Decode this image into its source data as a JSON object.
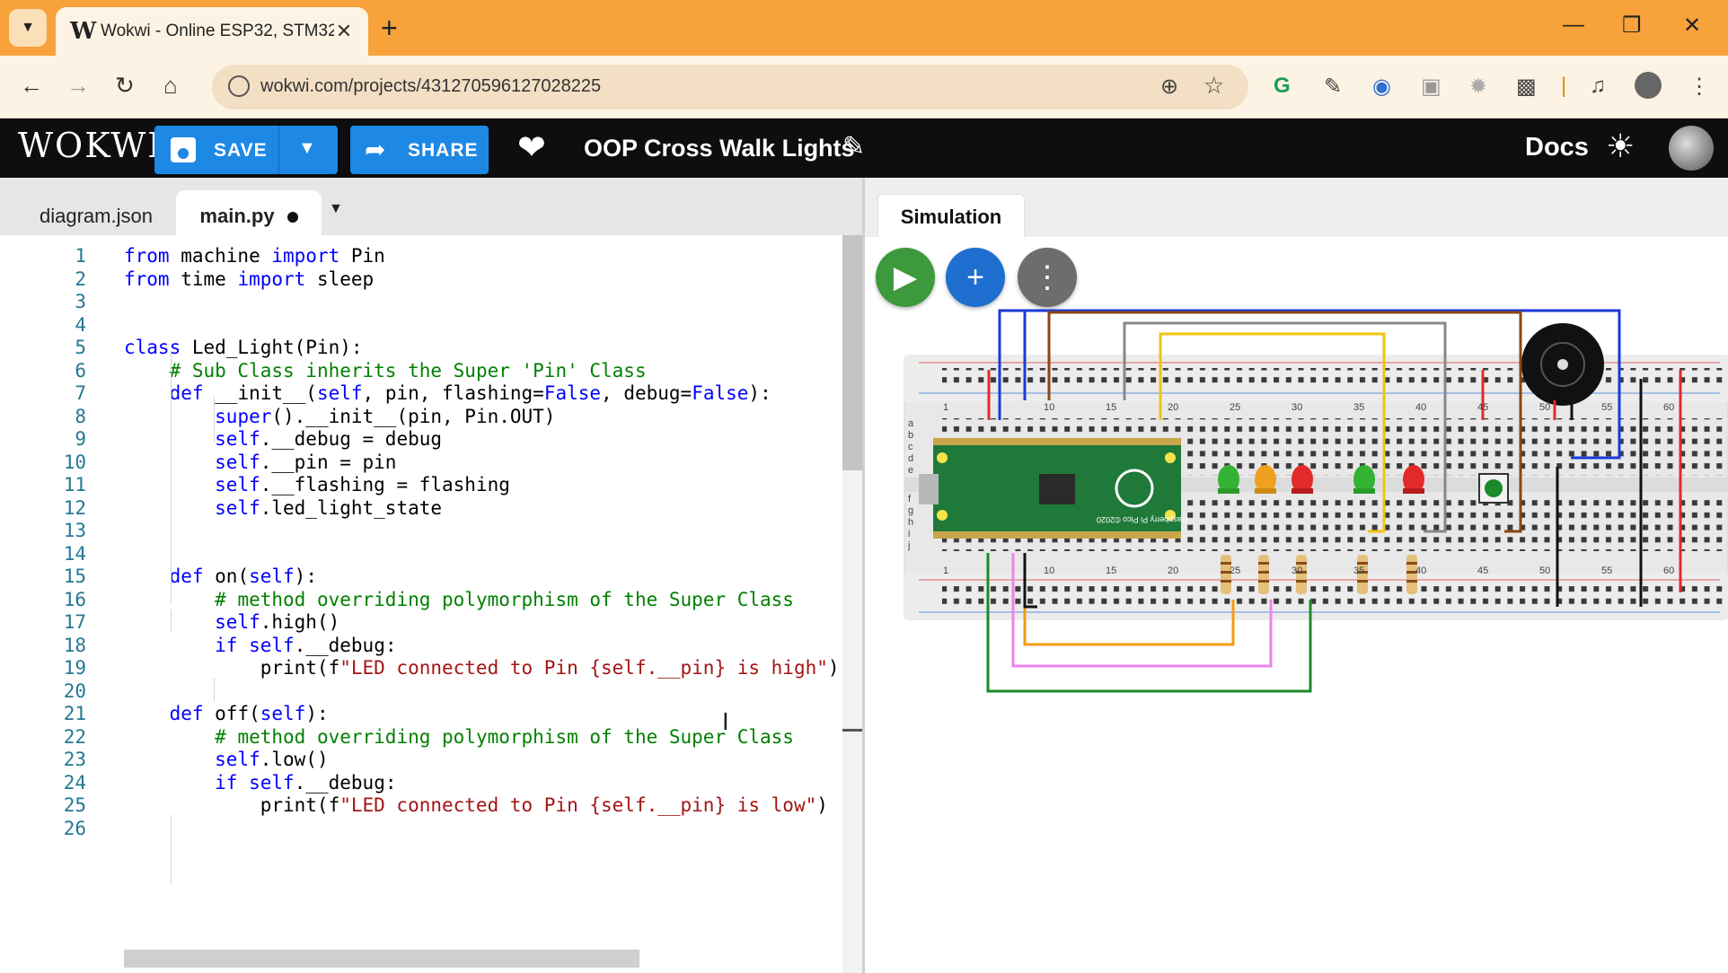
{
  "browser": {
    "tab_title": "Wokwi - Online ESP32, STM32, ",
    "favicon": "W",
    "url": "wokwi.com/projects/431270596127028225"
  },
  "header": {
    "logo": "WOKWI",
    "save_label": "SAVE",
    "share_label": "SHARE",
    "project_title": "OOP Cross Walk Lights",
    "docs_label": "Docs"
  },
  "editor": {
    "tabs": [
      {
        "label": "diagram.json",
        "active": false
      },
      {
        "label": "main.py",
        "active": true,
        "modified": true
      }
    ],
    "lines": [
      {
        "n": "1",
        "t": "from machine import Pin"
      },
      {
        "n": "2",
        "t": "from time import sleep"
      },
      {
        "n": "3",
        "t": ""
      },
      {
        "n": "4",
        "t": ""
      },
      {
        "n": "5",
        "t": "class Led_Light(Pin):"
      },
      {
        "n": "6",
        "t": "    # Sub Class inherits the Super 'Pin' Class"
      },
      {
        "n": "7",
        "t": "    def __init__(self, pin, flashing=False, debug=False):"
      },
      {
        "n": "8",
        "t": "        super().__init__(pin, Pin.OUT)"
      },
      {
        "n": "9",
        "t": "        self.__debug = debug"
      },
      {
        "n": "10",
        "t": "        self.__pin = pin"
      },
      {
        "n": "11",
        "t": "        self.__flashing = flashing"
      },
      {
        "n": "12",
        "t": "        self.led_light_state"
      },
      {
        "n": "13",
        "t": ""
      },
      {
        "n": "14",
        "t": ""
      },
      {
        "n": "15",
        "t": "    def on(self):"
      },
      {
        "n": "16",
        "t": "        # method overriding polymorphism of the Super Class"
      },
      {
        "n": "17",
        "t": "        self.high()"
      },
      {
        "n": "18",
        "t": "        if self.__debug:"
      },
      {
        "n": "19",
        "t": "            print(f\"LED connected to Pin {self.__pin} is high\")"
      },
      {
        "n": "20",
        "t": ""
      },
      {
        "n": "21",
        "t": "    def off(self):"
      },
      {
        "n": "22",
        "t": "        # method overriding polymorphism of the Super Class"
      },
      {
        "n": "23",
        "t": "        self.low()"
      },
      {
        "n": "24",
        "t": "        if self.__debug:"
      },
      {
        "n": "25",
        "t": "            print(f\"LED connected to Pin {self.__pin} is low\")"
      },
      {
        "n": "26",
        "t": ""
      }
    ]
  },
  "simulation": {
    "tab_label": "Simulation",
    "board_label": "Raspberry Pi Pico ©2020",
    "row_numbers": [
      "1",
      "10",
      "15",
      "20",
      "25",
      "30",
      "35",
      "40",
      "45",
      "50",
      "55",
      "60"
    ],
    "row_letters_top": [
      "a",
      "b",
      "c",
      "d",
      "e"
    ],
    "row_letters_bottom": [
      "f",
      "g",
      "h",
      "i",
      "j"
    ]
  },
  "colors": {
    "tabstrip": "#f7a23a",
    "header": "#0e0e10",
    "button": "#1e88e5",
    "play": "#3c9a3c",
    "keyword": "#0000ff",
    "comment": "#008000",
    "string": "#a31515"
  }
}
